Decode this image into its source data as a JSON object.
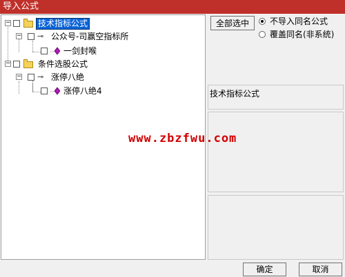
{
  "window": {
    "title": "导入公式"
  },
  "tree": {
    "nodes": [
      {
        "label": "技术指标公式"
      },
      {
        "label": "公众号-司赢空指标所"
      },
      {
        "label": "一剑封喉"
      },
      {
        "label": "条件选股公式"
      },
      {
        "label": "涨停八绝"
      },
      {
        "label": "涨停八绝4"
      }
    ]
  },
  "options": {
    "select_all_label": "全部选中",
    "radios": [
      {
        "label": "不导入同名公式",
        "checked": true
      },
      {
        "label": "覆盖同名(非系统)",
        "checked": false
      }
    ]
  },
  "description": {
    "label": "技术指标公式"
  },
  "watermark": {
    "text": "www.zbzfwu.com"
  },
  "footer": {
    "ok_label": "确定",
    "cancel_label": "取消"
  }
}
